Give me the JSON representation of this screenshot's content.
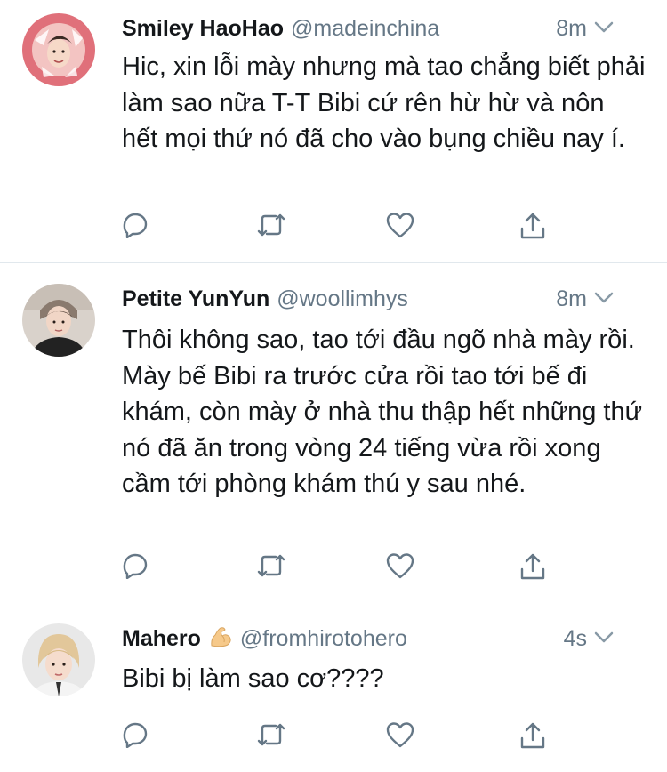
{
  "tweets": [
    {
      "name": "Smiley HaoHao",
      "handle": "@madeinchina",
      "time": "8m",
      "text": "Hic, xin lỗi mày nhưng mà tao chẳng biết phải làm sao nữa T-T Bibi cứ rên hừ hừ và nôn hết mọi thứ nó đã cho vào bụng chiều nay í."
    },
    {
      "name": "Petite YunYun",
      "handle": "@woollimhys",
      "time": "8m",
      "text": "Thôi không sao, tao tới đầu ngõ nhà mày rồi. Mày bế Bibi ra trước cửa rồi tao tới bế đi khám, còn mày ở nhà thu thập hết những thứ nó đã ăn trong vòng 24 tiếng vừa rồi xong cầm tới phòng khám thú y sau nhé."
    },
    {
      "name": "Mahero",
      "name_emoji": "flexed-biceps-emoji",
      "handle": "@fromhirotohero",
      "time": "4s",
      "text": "Bibi bị làm sao cơ????"
    }
  ],
  "icons": {
    "reply": "reply-icon",
    "retweet": "retweet-icon",
    "like": "heart-icon",
    "share": "share-icon",
    "menu": "chevron-down-icon"
  },
  "colors": {
    "text": "#14171a",
    "secondary": "#657786",
    "icon": "#657786",
    "divider": "#e1e8ed",
    "background": "#ffffff"
  }
}
